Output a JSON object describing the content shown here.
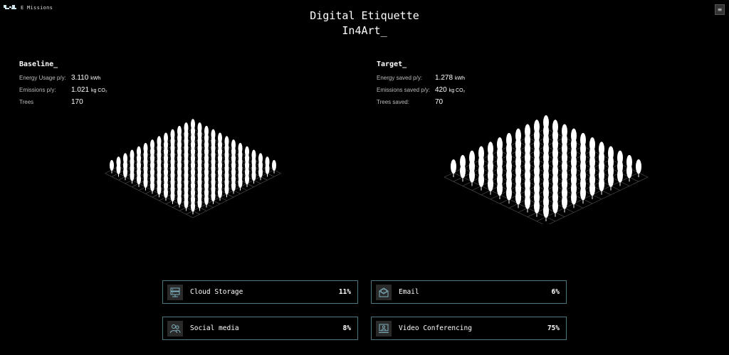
{
  "app": {
    "name": "E Missions",
    "menu_glyph": "≡"
  },
  "header": {
    "title": "Digital Etiquette",
    "subtitle": "In4Art_"
  },
  "baseline": {
    "heading": "Baseline_",
    "energy": {
      "label": "Energy Usage p/y:",
      "value": "3.110",
      "unit": "kWh"
    },
    "emissions": {
      "label": "Emissions p/y:",
      "value": "1.021",
      "unit": "kg CO₂"
    },
    "trees": {
      "label": "Trees",
      "value": "170"
    }
  },
  "target": {
    "heading": "Target_",
    "energy": {
      "label": "Energy saved p/y:",
      "value": "1.278",
      "unit": "kWh"
    },
    "emissions": {
      "label": "Emissions saved p/y:",
      "value": "420",
      "unit": "kg CO₂"
    },
    "trees": {
      "label": "Trees saved:",
      "value": "70"
    }
  },
  "categories": [
    {
      "name": "Cloud Storage",
      "percent": "11%",
      "icon": "server-icon"
    },
    {
      "name": "Email",
      "percent": "6%",
      "icon": "envelope-icon"
    },
    {
      "name": "Social media",
      "percent": "8%",
      "icon": "users-icon"
    },
    {
      "name": "Video Conferencing",
      "percent": "75%",
      "icon": "monitor-person-icon"
    }
  ],
  "colors": {
    "background": "#000000",
    "card_border": "#4a7680",
    "icon_bg": "#2a2a2a",
    "tree": "#ffffff"
  }
}
